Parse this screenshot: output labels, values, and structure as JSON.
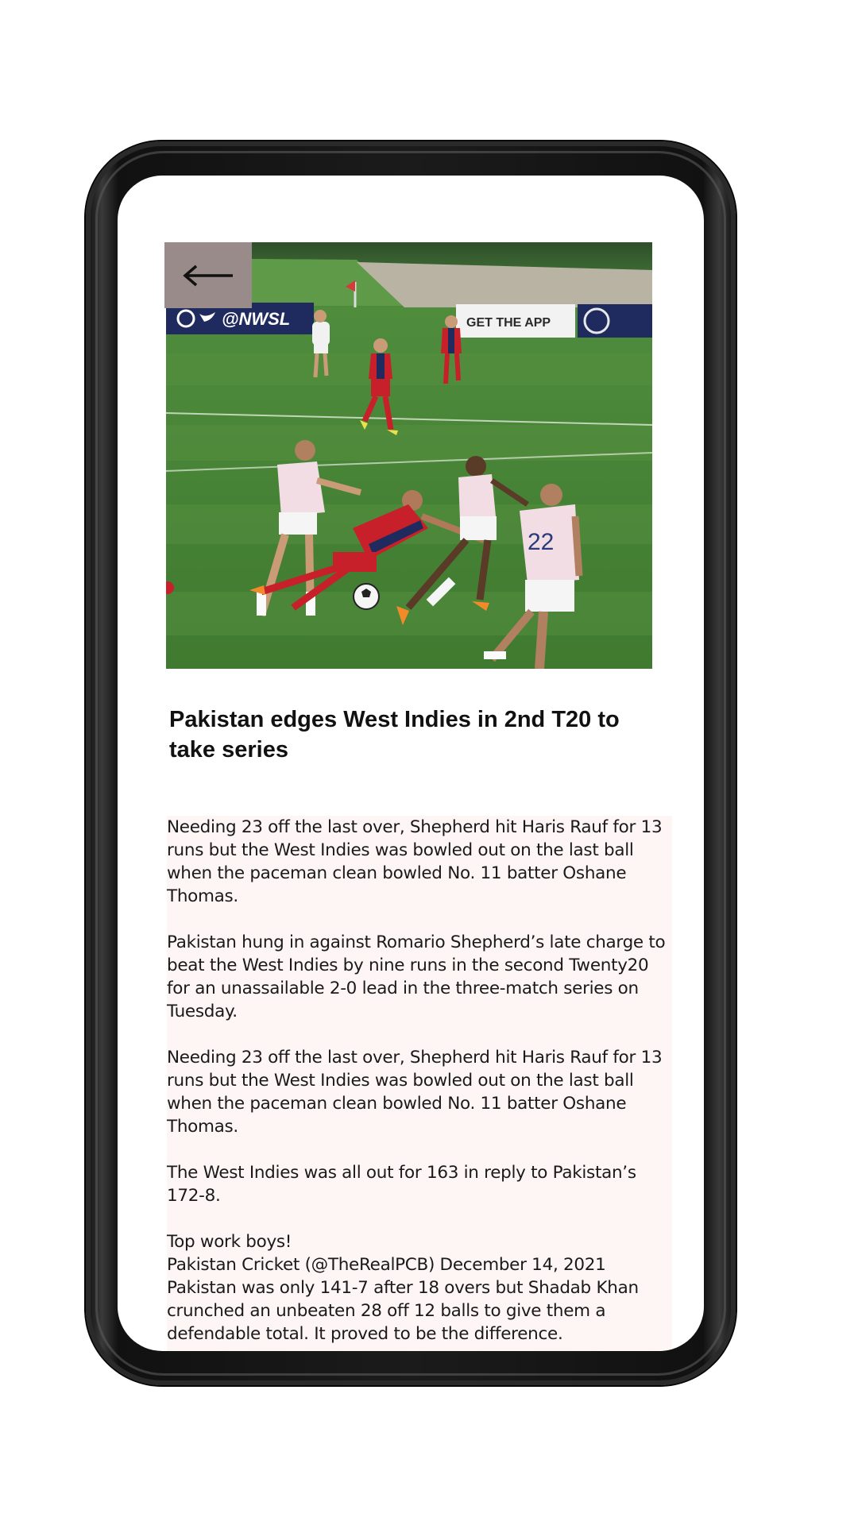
{
  "screen": {
    "back_button": {
      "icon": "arrow-left-icon",
      "glyph": "←"
    },
    "hero_image": {
      "description_icon": "soccer-match-photo"
    },
    "headline": "Pakistan edges West Indies in 2nd T20 to take series",
    "article": {
      "paragraphs": [
        "Needing 23 off the last over, Shepherd hit Haris Rauf for 13 runs but the West Indies was bowled out on the last ball when the paceman clean bowled No. 11 batter Oshane Thomas.",
        "Pakistan hung in against Romario Shepherd’s late charge to beat the West Indies by nine runs in the second Twenty20 for an unassailable 2-0 lead in the three-match series on Tuesday.",
        "Needing 23 off the last over, Shepherd hit Haris Rauf for 13 runs but the West Indies was bowled out on the last ball when the paceman clean bowled No. 11 batter Oshane Thomas.",
        "The West Indies was all out for 163 in reply to Pakistan’s 172-8."
      ],
      "tail_lines": [
        "Top work boys!",
        "Pakistan Cricket (@TheRealPCB) December 14, 2021",
        "Pakistan was only 141-7 after 18 overs but Shadab Khan crunched an unbeaten 28 off 12 balls to give them a defendable total. It proved to be the difference."
      ]
    },
    "photo_text": {
      "banner_left": "@NWSL",
      "banner_right": "GET THE APP",
      "jersey_number": "22"
    },
    "colors": {
      "back_button_bg": "#9a8b8b",
      "article_bg": "#fdf6f5",
      "pitch_green": "#4e8a3a",
      "frame": "#1b1b1b"
    }
  }
}
